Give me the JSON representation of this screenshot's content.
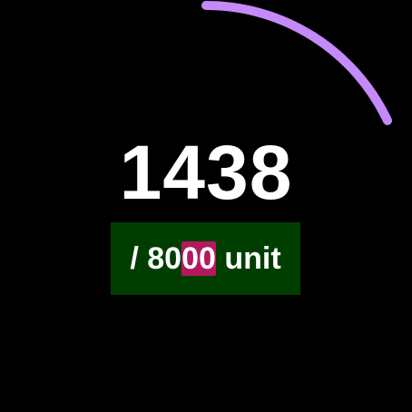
{
  "progress": {
    "current": 1438,
    "goal": 8000,
    "fraction": 0.18,
    "color": "#c58af9"
  },
  "display": {
    "value": "1438",
    "goal_prefix": "/ 80",
    "goal_highlight": "00",
    "goal_suffix": " unit"
  },
  "colors": {
    "background": "#000000",
    "text": "#ffffff",
    "goal_box": "#003e00",
    "highlight": "#b3195f"
  }
}
